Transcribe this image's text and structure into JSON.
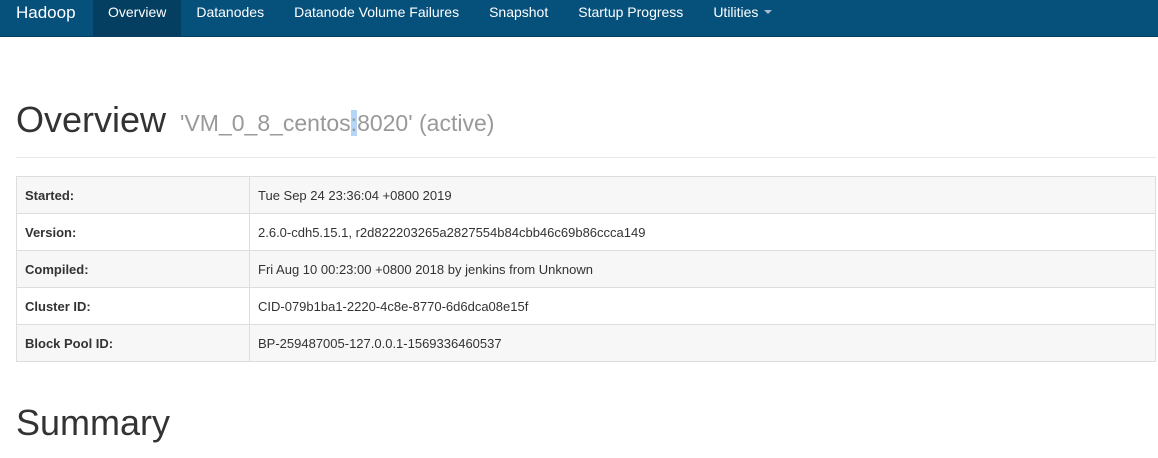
{
  "navbar": {
    "brand": "Hadoop",
    "items": [
      {
        "label": "Overview",
        "active": true
      },
      {
        "label": "Datanodes",
        "active": false
      },
      {
        "label": "Datanode Volume Failures",
        "active": false
      },
      {
        "label": "Snapshot",
        "active": false
      },
      {
        "label": "Startup Progress",
        "active": false
      },
      {
        "label": "Utilities",
        "active": false,
        "dropdown": true
      }
    ],
    "background_color": "#06507c",
    "active_color": "#043e61"
  },
  "header": {
    "title": "Overview",
    "subtitle_before": "'VM_0_8_centos",
    "subtitle_selected": ":",
    "subtitle_after": "8020' (active)"
  },
  "overview_table": {
    "rows": [
      {
        "label": "Started:",
        "value": "Tue Sep 24 23:36:04 +0800 2019"
      },
      {
        "label": "Version:",
        "value": "2.6.0-cdh5.15.1, r2d822203265a2827554b84cbb46c69b86ccca149"
      },
      {
        "label": "Compiled:",
        "value": "Fri Aug 10 00:23:00 +0800 2018 by jenkins from Unknown"
      },
      {
        "label": "Cluster ID:",
        "value": "CID-079b1ba1-2220-4c8e-8770-6d6dca08e15f"
      },
      {
        "label": "Block Pool ID:",
        "value": "BP-259487005-127.0.0.1-1569336460537"
      }
    ]
  },
  "summary": {
    "title": "Summary"
  }
}
